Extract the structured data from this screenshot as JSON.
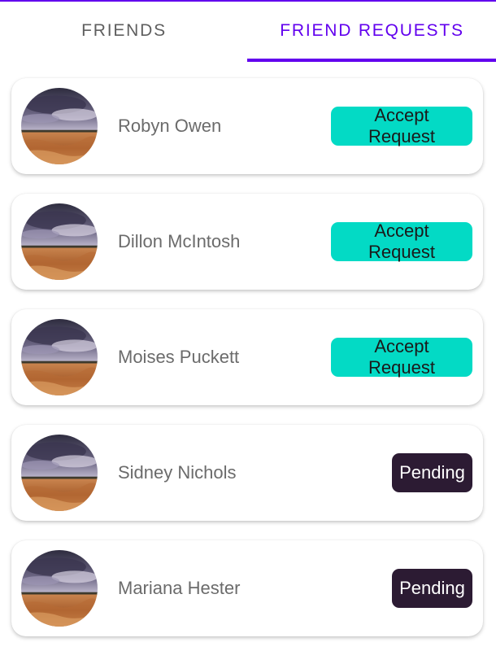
{
  "tabs": [
    {
      "label": "FRIENDS",
      "active": false
    },
    {
      "label": "FRIEND REQUESTS",
      "active": true
    }
  ],
  "colors": {
    "primary": "#6200ee",
    "accept": "#03dac5",
    "pending": "#2c1b33",
    "inactive_tab": "#5f5f5f",
    "name_text": "#6b6b6b"
  },
  "requests": [
    {
      "name": "Robyn Owen",
      "action": "Accept Request",
      "status": "accept"
    },
    {
      "name": "Dillon McIntosh",
      "action": "Accept Request",
      "status": "accept"
    },
    {
      "name": "Moises Puckett",
      "action": "Accept Request",
      "status": "accept"
    },
    {
      "name": "Sidney Nichols",
      "action": "Pending",
      "status": "pending"
    },
    {
      "name": "Mariana Hester",
      "action": "Pending",
      "status": "pending"
    }
  ]
}
